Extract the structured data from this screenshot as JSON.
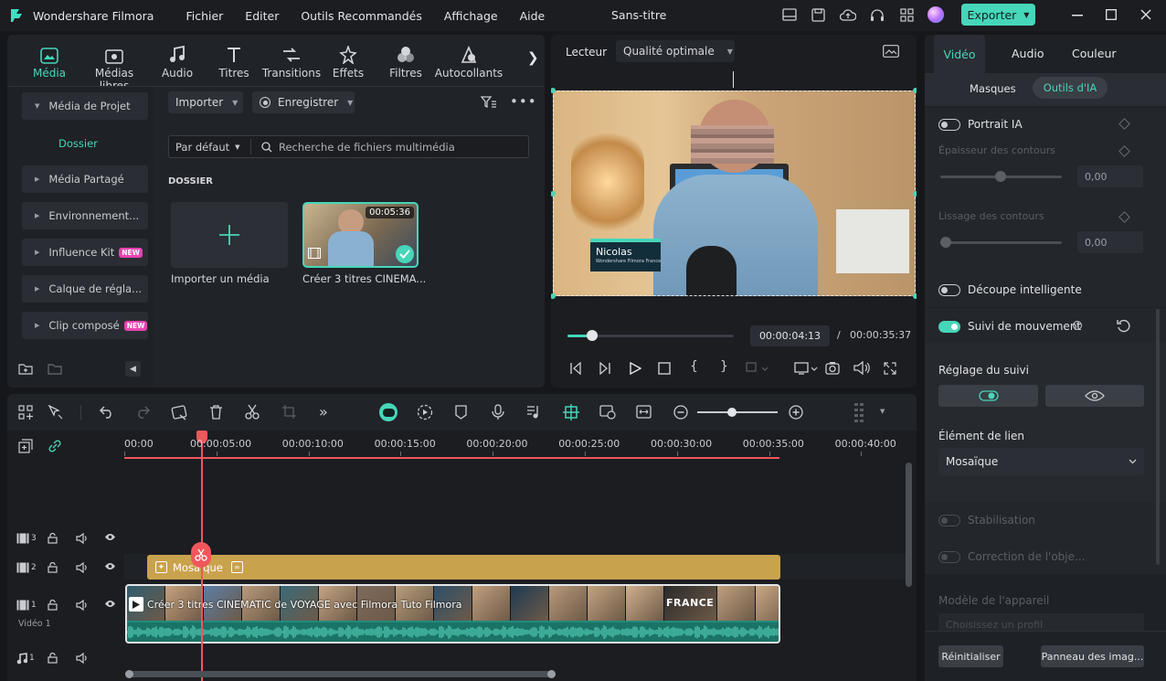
{
  "app": {
    "name": "Wondershare Filmora",
    "doc_title": "Sans-titre",
    "export_label": "Exporter"
  },
  "menu": [
    "Fichier",
    "Editer",
    "Outils Recommandés",
    "Affichage",
    "Aide"
  ],
  "media_tabs": [
    {
      "label": "Média",
      "icon": "media-icon"
    },
    {
      "label": "Médias libres",
      "icon": "stock-media-icon"
    },
    {
      "label": "Audio",
      "icon": "music-note-icon"
    },
    {
      "label": "Titres",
      "icon": "title-text-icon"
    },
    {
      "label": "Transitions",
      "icon": "transitions-icon"
    },
    {
      "label": "Effets",
      "icon": "effects-icon"
    },
    {
      "label": "Filtres",
      "icon": "filters-icon"
    },
    {
      "label": "Autocollants",
      "icon": "stickers-icon"
    }
  ],
  "sidebar": {
    "items": [
      {
        "label": "Média de Projet"
      },
      {
        "label": "Dossier"
      },
      {
        "label": "Média Partagé"
      },
      {
        "label": "Environnement..."
      },
      {
        "label": "Influence Kit",
        "badge": "NEW"
      },
      {
        "label": "Calque de régla..."
      },
      {
        "label": "Clip composé",
        "badge": "NEW"
      }
    ]
  },
  "library": {
    "import_label": "Importer",
    "record_label": "Enregistrer",
    "sort_label": "Par défaut",
    "search_placeholder": "Recherche de fichiers multimédia",
    "section_title": "DOSSIER",
    "import_media_label": "Importer un média",
    "clip_title": "Créer 3 titres CINEMA...",
    "clip_duration": "00:05:36"
  },
  "player": {
    "tab_label": "Lecteur",
    "quality": "Qualité optimale",
    "lower_third_name": "Nicolas",
    "lower_third_sub": "Wondershare Filmora France",
    "current_time": "00:00:04:13",
    "separator": "/",
    "total_time": "00:00:35:37",
    "progress": 0.146
  },
  "timeline": {
    "ruler": [
      "00:00",
      "00:00:05:00",
      "00:00:10:00",
      "00:00:15:00",
      "00:00:20:00",
      "00:00:25:00",
      "00:00:30:00",
      "00:00:35:00",
      "00:00:40:00"
    ],
    "tracks": [
      {
        "number": "3"
      },
      {
        "number": "2"
      },
      {
        "number": "1",
        "name": "Vidéo 1"
      },
      {
        "number": "1"
      }
    ],
    "effect_clip_label": "Mosaïque",
    "video_clip_label": "Créer 3 titres CINEMATIC de VOYAGE avec Filmora  Tuto Filmora",
    "frame_text": "FRANCE"
  },
  "right_panel": {
    "tabs": [
      "Vidéo",
      "Audio",
      "Couleur"
    ],
    "subtabs": [
      "Masques",
      "Outils d'IA"
    ],
    "portrait_label": "Portrait IA",
    "edge_thickness_label": "Épaisseur des contours",
    "edge_thickness_value": "0,00",
    "edge_smooth_label": "Lissage des contours",
    "edge_smooth_value": "0,00",
    "smart_cut_label": "Découpe intelligente",
    "motion_label": "Suivi de mouvement",
    "tracking_label": "Réglage du suivi",
    "link_label": "Élément de lien",
    "link_value": "Mosaïque",
    "stabilization_label": "Stabilisation",
    "correction_label": "Correction de l'obje...",
    "device_label": "Modèle de l'appareil",
    "profile_placeholder": "Choisissez un profil",
    "reset_label": "Réinitialiser",
    "panel_label": "Panneau des imag..."
  },
  "colors": {
    "accent": "#46d6b9",
    "playhead": "#f0575b",
    "effect_clip": "#c9a24d",
    "video_clip": "#1f8c7c"
  }
}
